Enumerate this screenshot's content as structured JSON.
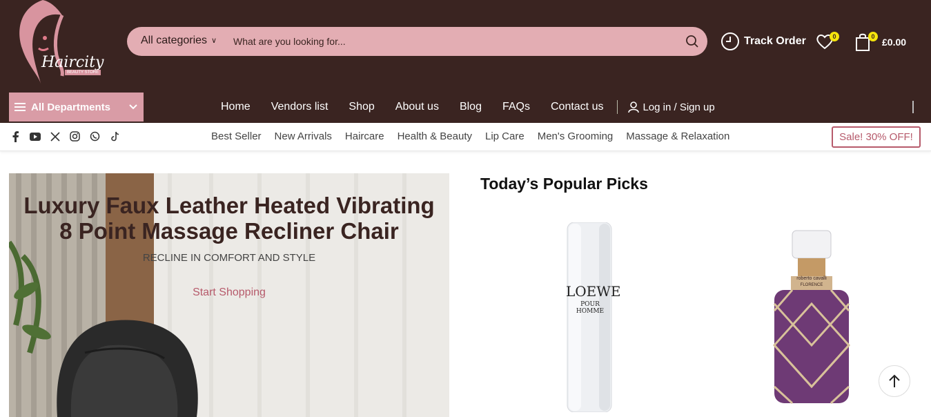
{
  "brand": {
    "name": "Haircity",
    "tagline": "BEAUTY STORE"
  },
  "search": {
    "category_label": "All categories",
    "placeholder": "What are you looking for..."
  },
  "header": {
    "track_order": "Track Order",
    "wishlist_count": "0",
    "cart_count": "0",
    "cart_total": "£0.00"
  },
  "nav": {
    "departments": "All Departments",
    "items": [
      "Home",
      "Vendors list",
      "Shop",
      "About us",
      "Blog",
      "FAQs",
      "Contact us"
    ],
    "login": "Log in / Sign up"
  },
  "social": [
    "facebook-icon",
    "youtube-icon",
    "x-icon",
    "instagram-icon",
    "whatsapp-icon",
    "tiktok-icon"
  ],
  "categories": [
    "Best Seller",
    "New Arrivals",
    "Haircare",
    "Health & Beauty",
    "Lip Care",
    "Men's Grooming",
    "Massage & Relaxation"
  ],
  "sale_badge": "Sale! 30% OFF!",
  "hero": {
    "title_line1": "Luxury Faux Leather Heated Vibrating",
    "title_line2": "8 Point Massage Recliner Chair",
    "subtitle": "RECLINE IN COMFORT AND STYLE",
    "cta": "Start Shopping"
  },
  "picks": {
    "title": "Today’s Popular Picks",
    "products": [
      {
        "brand": "LOEWE",
        "name": "POUR HOMME"
      },
      {
        "brand": "roberto cavalli",
        "name": "FLORENCE"
      }
    ]
  },
  "colors": {
    "header_bg": "#3a2421",
    "accent_pink": "#e3adb3",
    "sale_red": "#b65a6b",
    "badge_yellow": "#f5e50c"
  }
}
